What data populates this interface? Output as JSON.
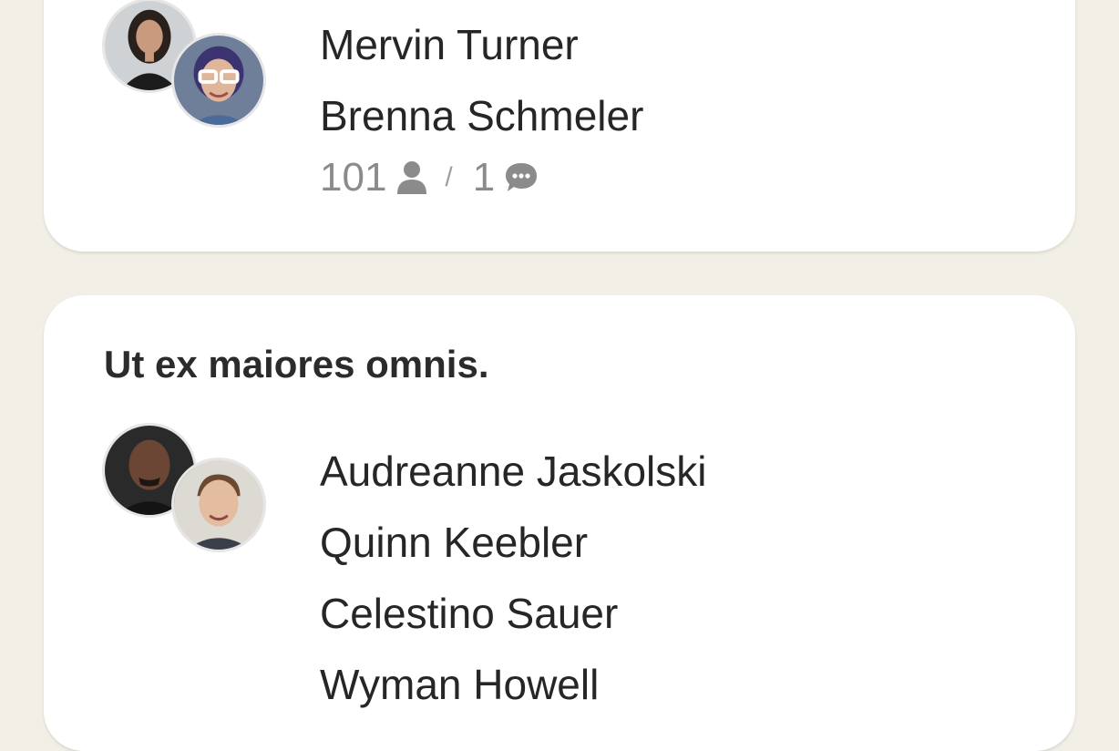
{
  "groups": [
    {
      "title": "",
      "avatars": [
        "avatar-woman-dark-hair",
        "avatar-woman-glasses"
      ],
      "members": [
        "Mervin Turner",
        "Brenna Schmeler"
      ],
      "stats": {
        "participants": "101",
        "separator": "/",
        "comments": "1"
      }
    },
    {
      "title": "Ut ex maiores omnis.",
      "avatars": [
        "avatar-man-bald",
        "avatar-young-man"
      ],
      "members": [
        "Audreanne Jaskolski",
        "Quinn Keebler",
        "Celestino Sauer",
        "Wyman Howell"
      ]
    }
  ],
  "icons": {
    "participants": "person-icon",
    "comments": "speech-bubble-icon"
  },
  "colors": {
    "background": "#f1efe6",
    "card": "#ffffff",
    "muted_text": "#8b8b8b"
  }
}
